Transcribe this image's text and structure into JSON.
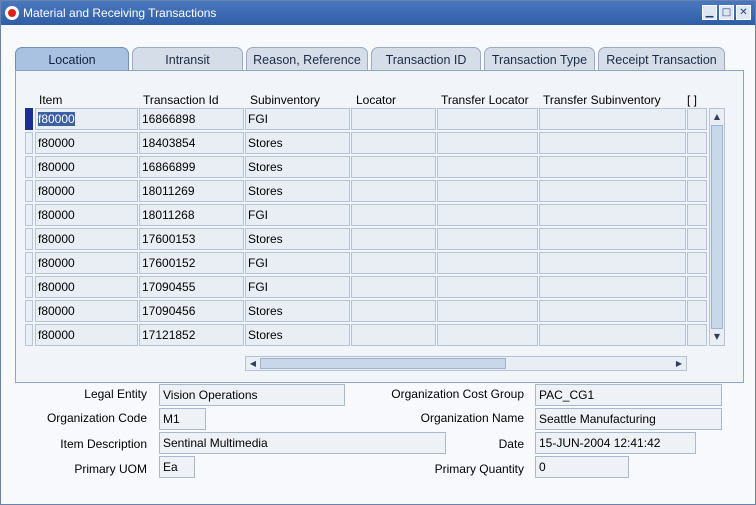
{
  "window": {
    "title": "Material and Receiving Transactions"
  },
  "tabs": [
    "Location",
    "Intransit",
    "Reason, Reference",
    "Transaction ID",
    "Transaction Type",
    "Receipt Transaction"
  ],
  "table": {
    "headers": [
      "Item",
      "Transaction Id",
      "Subinventory",
      "Locator",
      "Transfer Locator",
      "Transfer Subinventory",
      "[ ]"
    ],
    "rows": [
      [
        "f80000",
        "16866898",
        "FGI"
      ],
      [
        "f80000",
        "18403854",
        "Stores"
      ],
      [
        "f80000",
        "16866899",
        "Stores"
      ],
      [
        "f80000",
        "18011269",
        "Stores"
      ],
      [
        "f80000",
        "18011268",
        "FGI"
      ],
      [
        "f80000",
        "17600153",
        "Stores"
      ],
      [
        "f80000",
        "17600152",
        "FGI"
      ],
      [
        "f80000",
        "17090455",
        "FGI"
      ],
      [
        "f80000",
        "17090456",
        "Stores"
      ],
      [
        "f80000",
        "17121852",
        "Stores"
      ]
    ]
  },
  "details": {
    "legal_entity_label": "Legal Entity",
    "legal_entity": "Vision Operations",
    "org_cost_group_label": "Organization Cost Group",
    "org_cost_group": "PAC_CG1",
    "org_code_label": "Organization Code",
    "org_code": "M1",
    "org_name_label": "Organization Name",
    "org_name": "Seattle Manufacturing",
    "item_desc_label": "Item Description",
    "item_desc": "Sentinal Multimedia",
    "date_label": "Date",
    "date": "15-JUN-2004 12:41:42",
    "primary_uom_label": "Primary UOM",
    "primary_uom": "Ea",
    "primary_qty_label": "Primary Quantity",
    "primary_qty": "0"
  }
}
